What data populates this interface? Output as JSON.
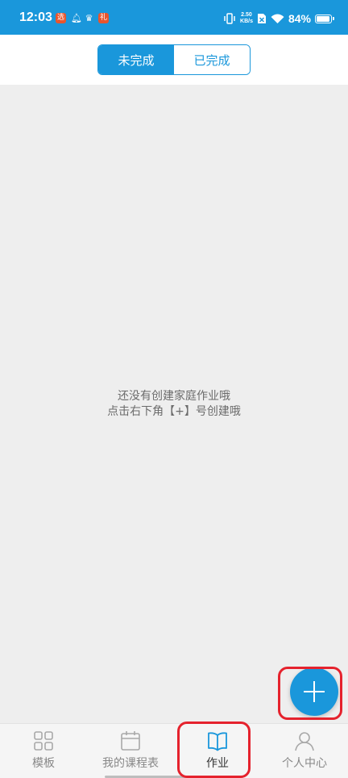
{
  "status_bar": {
    "time": "12:03",
    "net_speed_value": "2.50",
    "net_speed_unit": "KB/s",
    "battery": "84%"
  },
  "tabs": {
    "incomplete": "未完成",
    "complete": "已完成"
  },
  "empty_state": {
    "line1": "还没有创建家庭作业哦",
    "line2": "点击右下角【+】号创建哦"
  },
  "nav": {
    "templates": "模板",
    "my_schedule": "我的课程表",
    "homework": "作业",
    "profile": "个人中心"
  },
  "colors": {
    "accent": "#1a97db",
    "highlight": "#e5222d"
  }
}
